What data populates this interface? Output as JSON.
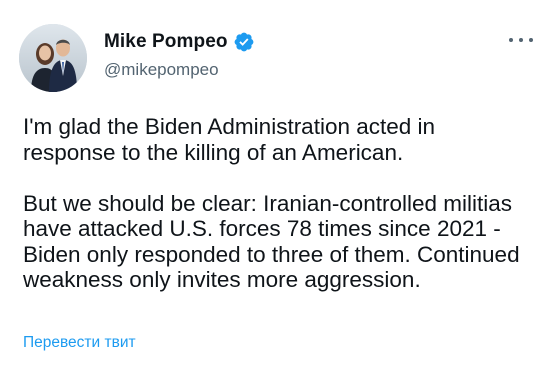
{
  "author": {
    "display_name": "Mike Pompeo",
    "handle": "@mikepompeo",
    "verified": true,
    "avatar_icon": "profile-photo",
    "verified_icon": "verified-badge-icon"
  },
  "menu": {
    "icon": "more-options-icon"
  },
  "tweet": {
    "paragraph_1": "I'm glad the Biden Administration acted in response to the killing of an American.",
    "paragraph_2": "But we should be clear: Iranian-controlled militias have attacked U.S. forces 78 times since 2021 - Biden only responded to three of them. Continued weakness only invites more aggression.",
    "translate_label": "Перевести твит"
  },
  "colors": {
    "text": "#0f1419",
    "secondary": "#536471",
    "accent": "#1d9bf0"
  }
}
